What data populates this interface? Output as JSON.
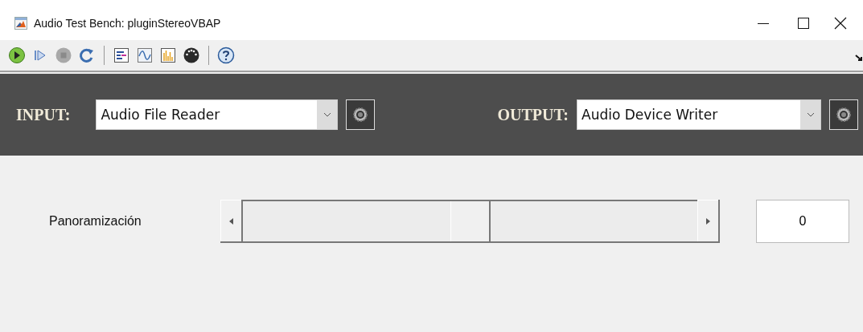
{
  "window": {
    "title": "Audio Test Bench: pluginStereoVBAP"
  },
  "toolbar": [
    {
      "kind": "run"
    },
    {
      "kind": "step"
    },
    {
      "kind": "stop"
    },
    {
      "kind": "reset"
    },
    {
      "kind": "separator"
    },
    {
      "kind": "generate"
    },
    {
      "kind": "scope"
    },
    {
      "kind": "analyzer"
    },
    {
      "kind": "midi"
    },
    {
      "kind": "separator"
    },
    {
      "kind": "help"
    }
  ],
  "input": {
    "label": "INPUT:",
    "value": "Audio File Reader"
  },
  "output": {
    "label": "OUTPUT:",
    "value": "Audio Device Writer"
  },
  "parameters": [
    {
      "name": "Panoramización",
      "level": 0.5,
      "value": "0"
    }
  ]
}
